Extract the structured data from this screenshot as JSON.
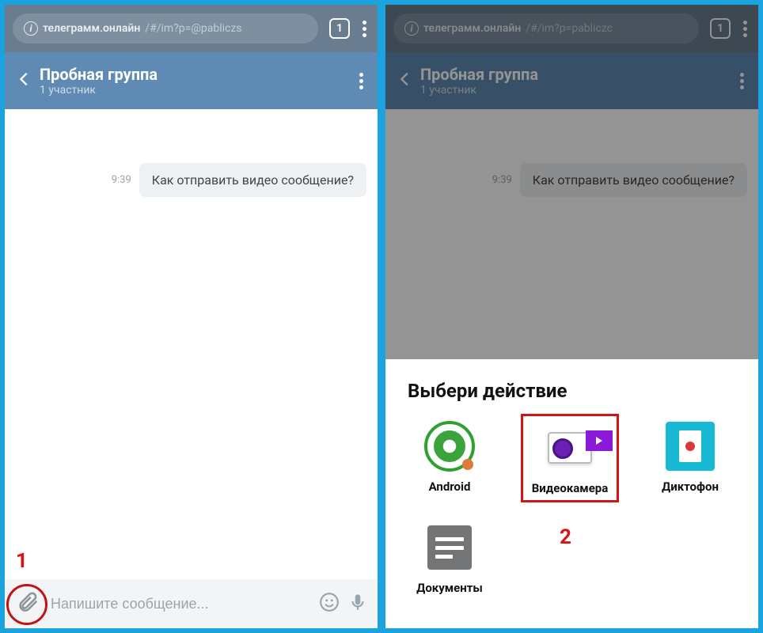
{
  "left": {
    "url_host": "телеграмм.онлайн",
    "url_path": "/#/im?p=@pabliczs",
    "tab_count": "1",
    "header": {
      "title": "Пробная группа",
      "subtitle": "1 участник"
    },
    "message": {
      "time": "9:39",
      "text": "Как отправить видео сообщение?"
    },
    "input_placeholder": "Напишите сообщение...",
    "annotation": "1"
  },
  "right": {
    "url_host": "телеграмм.онлайн",
    "url_path": "/#/im?p=pabliczc",
    "tab_count": "1",
    "header": {
      "title": "Пробная группа",
      "subtitle": "1 участник"
    },
    "message": {
      "time": "9:39",
      "text": "Как отправить видео сообщение?"
    },
    "sheet": {
      "title": "Выбери действие",
      "items": [
        {
          "label": "Android"
        },
        {
          "label": "Видеокамера"
        },
        {
          "label": "Диктофон"
        },
        {
          "label": "Документы"
        }
      ],
      "annotation": "2"
    }
  }
}
